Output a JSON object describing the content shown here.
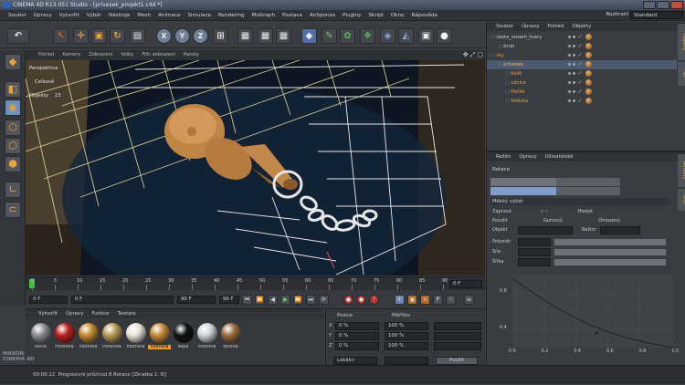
{
  "window": {
    "title": "CINEMA 4D R13.051 Studio - [privesek_projekt1.c4d *]"
  },
  "menu": [
    "Soubor",
    "Úpravy",
    "Vytvořit",
    "Výběr",
    "Nástroje",
    "Mesh",
    "Animace",
    "Simulace",
    "Rendering",
    "MoGraph",
    "Postava",
    "AnSporizo",
    "Pluginy",
    "Skript",
    "Okno",
    "Nápověda"
  ],
  "layout": {
    "label": "Rozhraní",
    "value": "Standard"
  },
  "toolbar": {
    "x": "X",
    "y": "Y",
    "z": "Z"
  },
  "viewport": {
    "menu": [
      "Pohled",
      "Kamery",
      "Zobrazení",
      "Volby",
      "Filtr zobrazení",
      "Panely"
    ],
    "label": "Perspektiva",
    "info_label": "Celkově",
    "objects_label": "Objekty",
    "objects_count": "23"
  },
  "timeline": {
    "ticks": [
      "0",
      "5",
      "10",
      "15",
      "20",
      "25",
      "30",
      "35",
      "40",
      "45",
      "50",
      "55",
      "60",
      "65",
      "70",
      "75",
      "80",
      "85",
      "90"
    ],
    "end": "0 F"
  },
  "transport": {
    "start": "0 F",
    "current": "0 F",
    "end": "90 F",
    "max": "90 F"
  },
  "materials": {
    "menu": [
      "Vytvořit",
      "Úpravy",
      "Funkce",
      "Textura"
    ],
    "items": [
      {
        "name": "kenie",
        "color": "#8a8c90"
      },
      {
        "name": "Hodnota",
        "color": "#b8211c"
      },
      {
        "name": "hodnota",
        "color": "#c08a2a"
      },
      {
        "name": "Hodnota",
        "color": "#b79a55"
      },
      {
        "name": "hodnota",
        "color": "#e8e3d6"
      },
      {
        "name": "hodnota",
        "color": "#c58a3a",
        "selected": true
      },
      {
        "name": "kopa",
        "color": "#111111"
      },
      {
        "name": "hodnota",
        "color": "#cfd2d6"
      },
      {
        "name": "obloha",
        "color": "#9a6a3c"
      }
    ]
  },
  "coords": {
    "pos_label": "Pozice",
    "scale_label": "Měřítko",
    "rows": [
      {
        "axis": "X",
        "pos": "0 %",
        "scale": "100 %"
      },
      {
        "axis": "Y",
        "pos": "0 %",
        "scale": "100 %"
      },
      {
        "axis": "Z",
        "pos": "0 %",
        "scale": "100 %"
      }
    ],
    "space": "Lokální",
    "apply": "Použít"
  },
  "objmgr": {
    "menu": [
      "Soubor",
      "Úpravy",
      "Pohled",
      "Objekty"
    ],
    "items": [
      {
        "name": "cesta_voxem_tvary",
        "indent": 0,
        "color": "#d0d3d8"
      },
      {
        "name": "bruh",
        "indent": 1,
        "color": "#d0d3d8"
      },
      {
        "name": "sky",
        "indent": 0,
        "color": "#e7a33a"
      },
      {
        "name": "privesek",
        "indent": 1,
        "color": "#ffb43c",
        "selected": true
      },
      {
        "name": "Kolík",
        "indent": 2,
        "color": "#e7a33a"
      },
      {
        "name": "ušnice",
        "indent": 2,
        "color": "#e7a33a"
      },
      {
        "name": "Hořák",
        "indent": 2,
        "color": "#e7a33a"
      },
      {
        "name": "řetězka",
        "indent": 2,
        "color": "#e7a33a"
      }
    ]
  },
  "attrmgr": {
    "menu": [
      "Režim",
      "Úpravy",
      "Uživatelské"
    ],
    "object": "Rotace",
    "section": "Měkký výběr",
    "rows": [
      [
        "Zapnout",
        "Hledat"
      ],
      [
        "Povolit",
        "Gumový",
        "Omezený"
      ]
    ],
    "fields": [
      "Objekt",
      "Režim"
    ],
    "sliders": [
      "Poloměr",
      "Síla",
      "Šířka"
    ],
    "graph_x": [
      "0.0",
      "0.2",
      "0.4",
      "0.6",
      "0.8",
      "1.0"
    ],
    "graph_y": [
      "0.8",
      "0.4"
    ]
  },
  "status": {
    "time": "00:00:12",
    "text": "Progresivní průchod 8   Rotace [Zkratka 1: R]"
  },
  "brand": {
    "line1": "MAXON",
    "line2": "CINEMA 4D"
  }
}
